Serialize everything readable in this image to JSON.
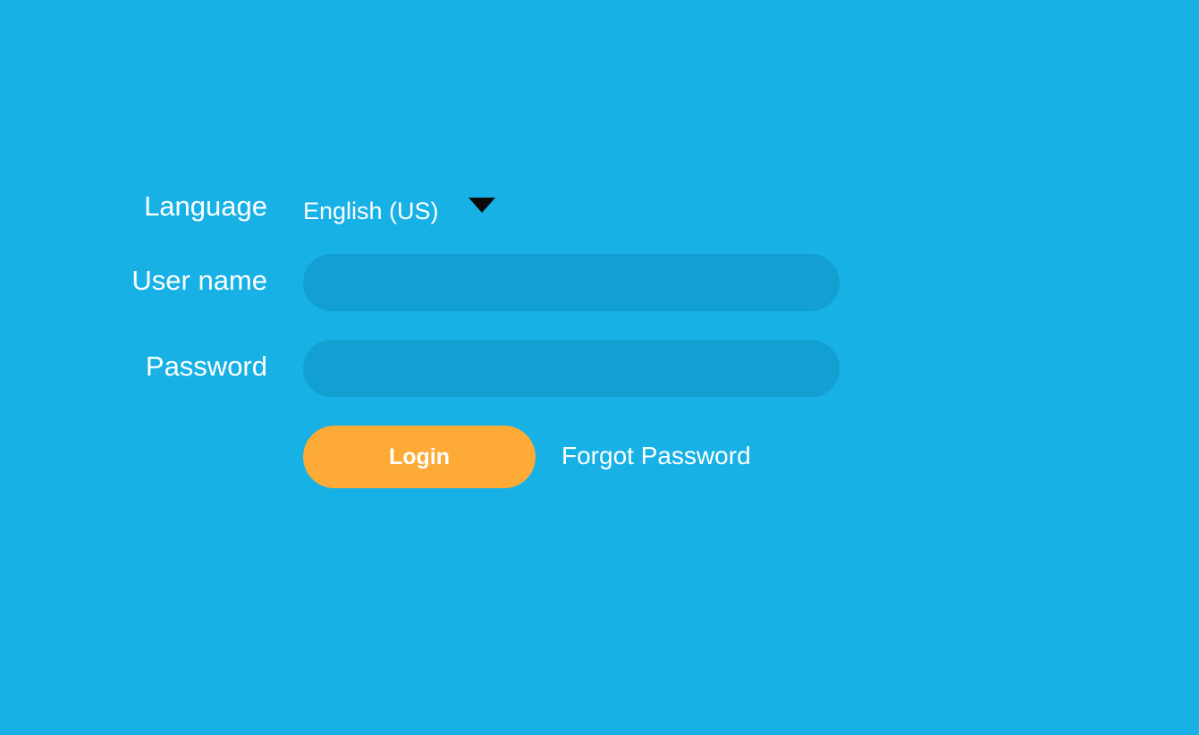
{
  "colors": {
    "background": "#17b1e6",
    "input_fill": "#139fd2",
    "login_button": "#fdaa36",
    "text": "#ffffff",
    "dropdown_arrow": "#0a0a0a"
  },
  "form": {
    "language": {
      "label": "Language",
      "selected": "English (US)",
      "icon": "chevron-down-icon"
    },
    "username": {
      "label": "User name",
      "value": "",
      "placeholder": ""
    },
    "password": {
      "label": "Password",
      "value": "",
      "placeholder": ""
    },
    "login_label": "Login",
    "forgot_label": "Forgot Password"
  }
}
